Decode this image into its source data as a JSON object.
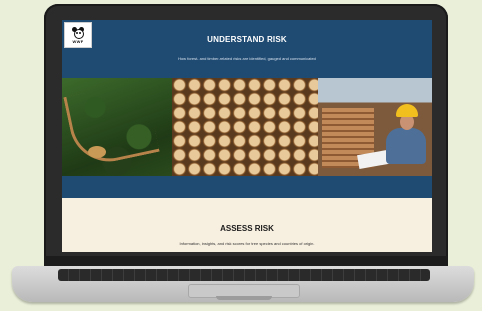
{
  "logo": {
    "text": "WWF",
    "icon": "panda-icon"
  },
  "hero": {
    "title": "UNDERSTAND RISK",
    "subtitle": "How forest- and timber-related risks are identified, gauged and communicated"
  },
  "photos": [
    {
      "name": "forest-aerial-photo"
    },
    {
      "name": "log-pile-photo"
    },
    {
      "name": "lumber-worker-photo"
    }
  ],
  "assess": {
    "title": "ASSESS RISK",
    "subtitle": "Information, insights, and risk scores for tree species and countries of origin."
  },
  "colors": {
    "header_blue": "#1f4a72",
    "section_cream": "#f7efe0",
    "background": "#e9efd9"
  }
}
